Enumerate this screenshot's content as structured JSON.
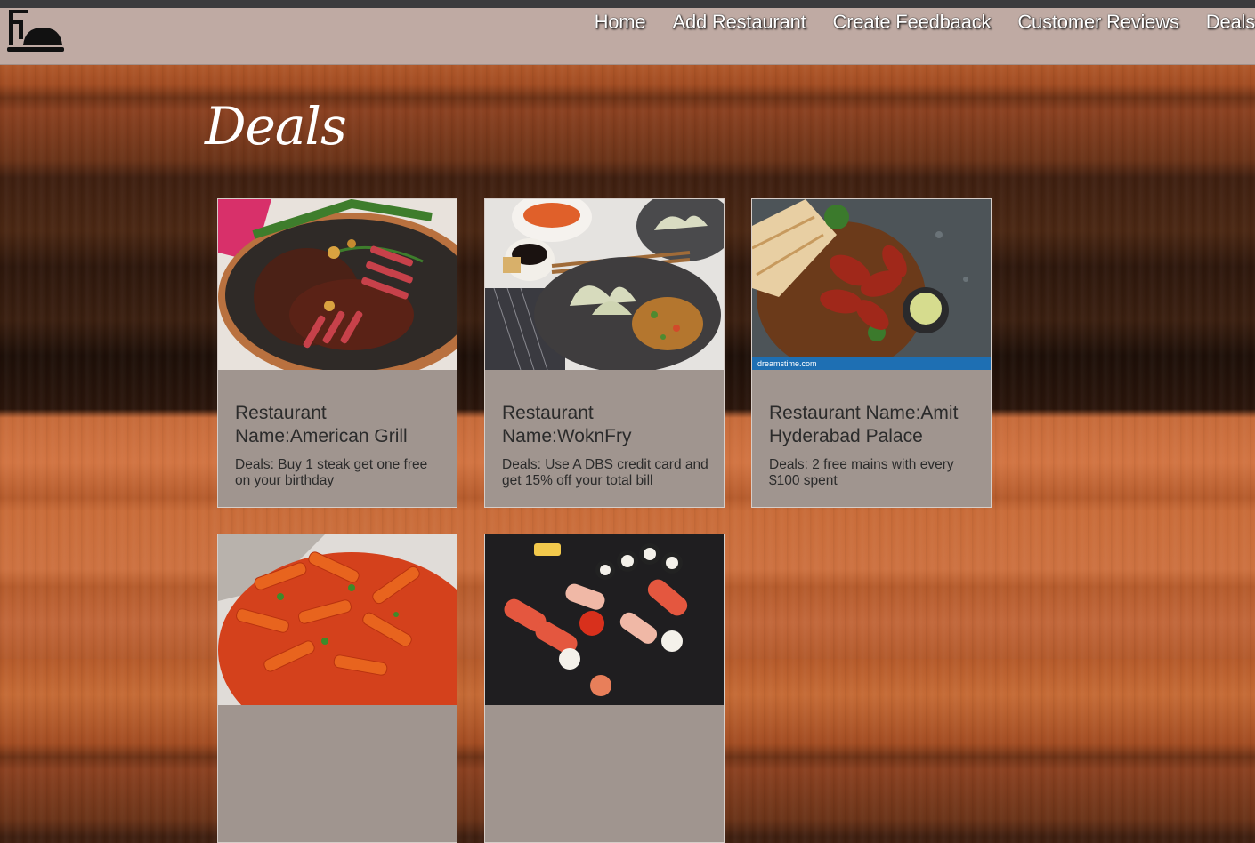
{
  "nav": {
    "links": [
      "Home",
      "Add Restaurant",
      "Create Feedbaack",
      "Customer Reviews",
      "Deals"
    ]
  },
  "page": {
    "title": "Deals"
  },
  "deals": [
    {
      "name": "Restaurant Name:American Grill",
      "deal": "Deals: Buy 1 steak get one free on your birthday",
      "image": "steak"
    },
    {
      "name": "Restaurant Name:WoknFry",
      "deal": "Deals: Use A DBS credit card and get 15% off your total bill",
      "image": "dumplings"
    },
    {
      "name": "Restaurant Name:Amit Hyderabad Palace",
      "deal": "Deals: 2 free mains with every $100 spent",
      "image": "chicken-wings",
      "watermark": "dreamstime.com"
    },
    {
      "image": "penne-pasta"
    },
    {
      "image": "sushi"
    }
  ]
}
